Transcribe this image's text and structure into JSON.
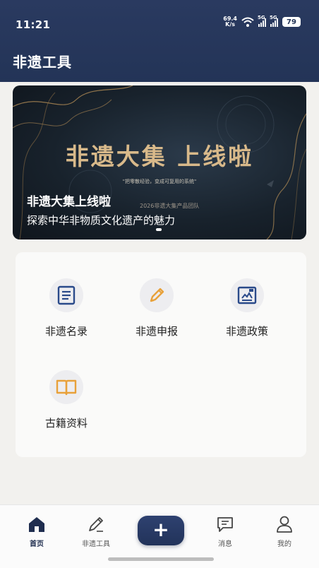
{
  "status": {
    "time": "11:21",
    "speed_value": "69.4",
    "speed_unit": "K/s",
    "sim1": "5G",
    "sim2": "5G",
    "battery": "79"
  },
  "header": {
    "title": "非遗工具"
  },
  "banner": {
    "headline": "非遗大集 上线啦",
    "small_text_1": "\"把零散经验，变成可复用的系统\"",
    "small_text_2": "2026非遗大集产品团队",
    "title": "非遗大集上线啦",
    "subtitle": "探索中华非物质文化遗产的魅力"
  },
  "tools": [
    {
      "label": "非遗名录",
      "icon": "document-list-icon"
    },
    {
      "label": "非遗申报",
      "icon": "pencil-icon"
    },
    {
      "label": "非遗政策",
      "icon": "policy-image-icon"
    },
    {
      "label": "古籍资料",
      "icon": "open-book-icon"
    }
  ],
  "bottom_nav": {
    "home": "首页",
    "tools": "非遗工具",
    "add": "+",
    "messages": "消息",
    "mine": "我的"
  },
  "colors": {
    "header_bg": "#233457",
    "accent_blue": "#2a4a8a",
    "accent_orange": "#e8a13a",
    "banner_gold": "#d8b98a"
  }
}
